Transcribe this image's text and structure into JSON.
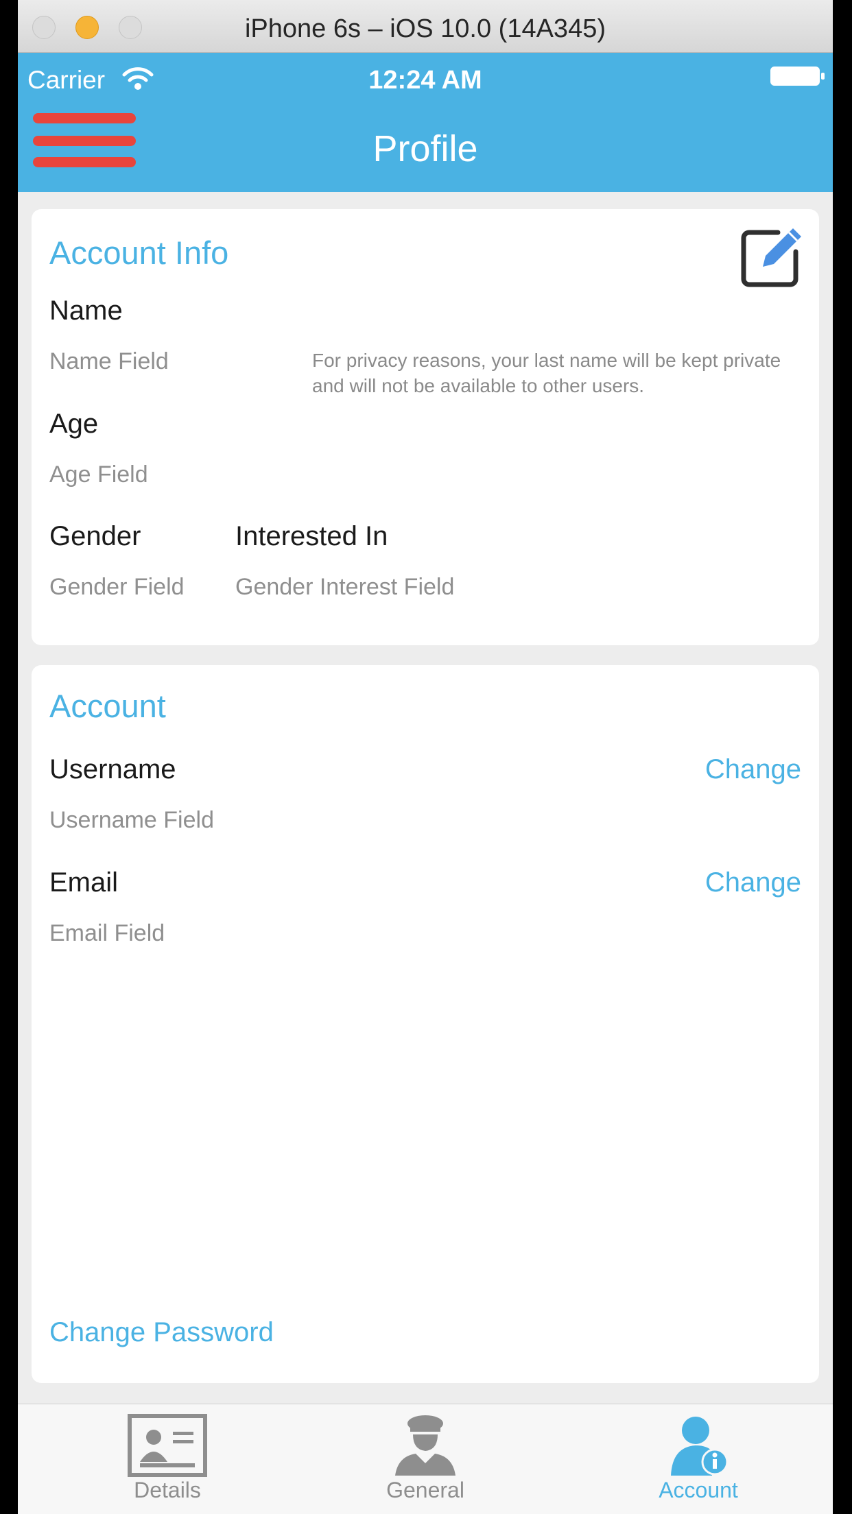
{
  "simulator": {
    "title": "iPhone 6s – iOS 10.0 (14A345)"
  },
  "status_bar": {
    "carrier": "Carrier",
    "time": "12:24 AM"
  },
  "nav": {
    "title": "Profile"
  },
  "account_info": {
    "title": "Account Info",
    "name_label": "Name",
    "name_value": "Name Field",
    "privacy_note": "For privacy reasons, your last name will be kept private and will not be available to other users.",
    "age_label": "Age",
    "age_value": "Age Field",
    "gender_label": "Gender",
    "gender_value": "Gender Field",
    "interest_label": "Interested In",
    "interest_value": "Gender Interest Field"
  },
  "account": {
    "title": "Account",
    "username_label": "Username",
    "username_value": "Username Field",
    "username_change": "Change",
    "email_label": "Email",
    "email_value": "Email Field",
    "email_change": "Change",
    "change_password": "Change Password"
  },
  "tabs": [
    {
      "label": "Details",
      "icon": "id-card-icon",
      "active": false
    },
    {
      "label": "General",
      "icon": "officer-icon",
      "active": false
    },
    {
      "label": "Account",
      "icon": "account-info-icon",
      "active": true
    }
  ],
  "colors": {
    "accent": "#4ab2e3",
    "menu": "#e8453c",
    "tab_inactive": "#8e8e8e",
    "tab_active": "#4ab2e3"
  }
}
